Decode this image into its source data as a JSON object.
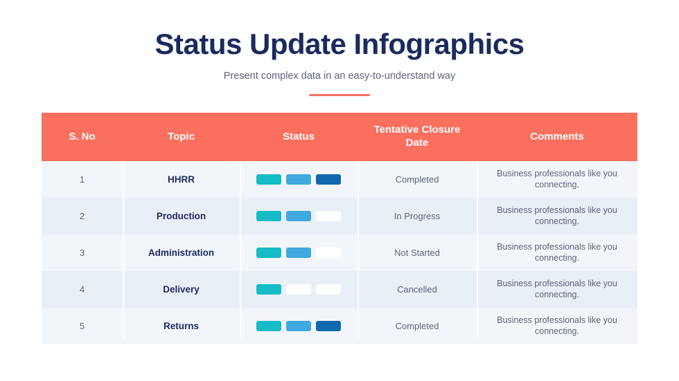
{
  "header": {
    "title": "Status Update Infographics",
    "subtitle": "Present complex data in an easy-to-understand way",
    "accent_color": "#fa6f5e",
    "title_color": "#1b2a5e"
  },
  "table": {
    "columns": [
      {
        "label": "S. No"
      },
      {
        "label": "Topic"
      },
      {
        "label": "Status"
      },
      {
        "label": "Tentative Closure Date"
      },
      {
        "label": "Comments"
      }
    ],
    "colors": {
      "header_bg": "#fa6f5e",
      "row_odd_bg": "#f2f6fa",
      "row_even_bg": "#e9eff6",
      "bar_teal": "#15bcc4",
      "bar_light_blue": "#3fa9e0",
      "bar_dark_blue": "#1068ae",
      "bar_empty": "#ffffff"
    },
    "rows": [
      {
        "sno": "1",
        "topic": "HHRR",
        "bars": [
          "#15bcc4",
          "#3fa9e0",
          "#1068ae"
        ],
        "date": "Completed",
        "comments": "Business professionals like you connecting."
      },
      {
        "sno": "2",
        "topic": "Production",
        "bars": [
          "#15bcc4",
          "#3fa9e0",
          "#ffffff"
        ],
        "date": "In Progress",
        "comments": "Business professionals like you connecting."
      },
      {
        "sno": "3",
        "topic": "Administration",
        "bars": [
          "#15bcc4",
          "#3fa9e0",
          "#ffffff"
        ],
        "date": "Not Started",
        "comments": "Business professionals like you connecting."
      },
      {
        "sno": "4",
        "topic": "Delivery",
        "bars": [
          "#15bcc4",
          "#ffffff",
          "#ffffff"
        ],
        "date": "Cancelled",
        "comments": "Business professionals like you connecting."
      },
      {
        "sno": "5",
        "topic": "Returns",
        "bars": [
          "#15bcc4",
          "#3fa9e0",
          "#1068ae"
        ],
        "date": "Completed",
        "comments": "Business professionals like you connecting."
      }
    ]
  }
}
